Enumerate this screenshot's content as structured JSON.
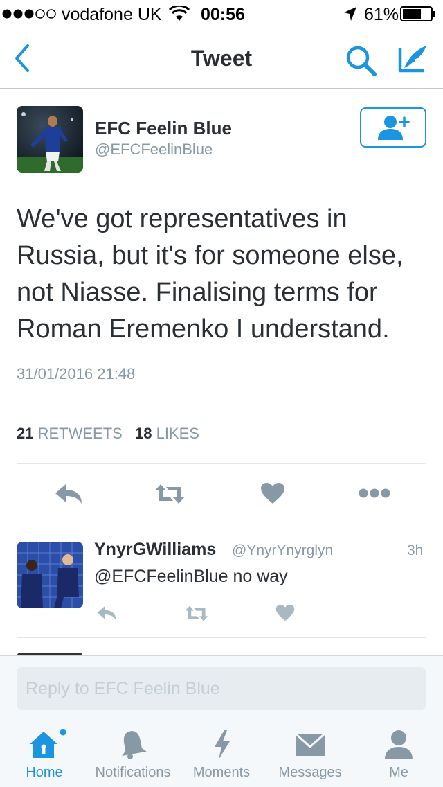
{
  "status_bar": {
    "carrier": "vodafone UK",
    "time": "00:56",
    "battery": "61%"
  },
  "nav": {
    "title": "Tweet"
  },
  "tweet": {
    "author_name": "EFC Feelin Blue",
    "author_handle": "@EFCFeelinBlue",
    "text": "We've got representatives in Russia, but it's for someone else, not Niasse. Finalising terms for Roman Eremenko I understand.",
    "timestamp": "31/01/2016 21:48",
    "retweets_count": "21",
    "retweets_label": "RETWEETS",
    "likes_count": "18",
    "likes_label": "LIKES"
  },
  "reply": {
    "name": "YnyrGWilliams",
    "handle": "@YnyrYnyrglyn",
    "time": "3h",
    "text": "@EFCFeelinBlue no way"
  },
  "composer": {
    "placeholder": "Reply to EFC Feelin Blue"
  },
  "tabs": [
    {
      "label": "Home",
      "icon": "home-icon",
      "active": true
    },
    {
      "label": "Notifications",
      "icon": "bell-icon",
      "active": false
    },
    {
      "label": "Moments",
      "icon": "lightning-icon",
      "active": false
    },
    {
      "label": "Messages",
      "icon": "envelope-icon",
      "active": false
    },
    {
      "label": "Me",
      "icon": "person-icon",
      "active": false
    }
  ],
  "colors": {
    "accent": "#1b95e0",
    "icon_gray": "#8899a6",
    "text": "#292f33"
  }
}
